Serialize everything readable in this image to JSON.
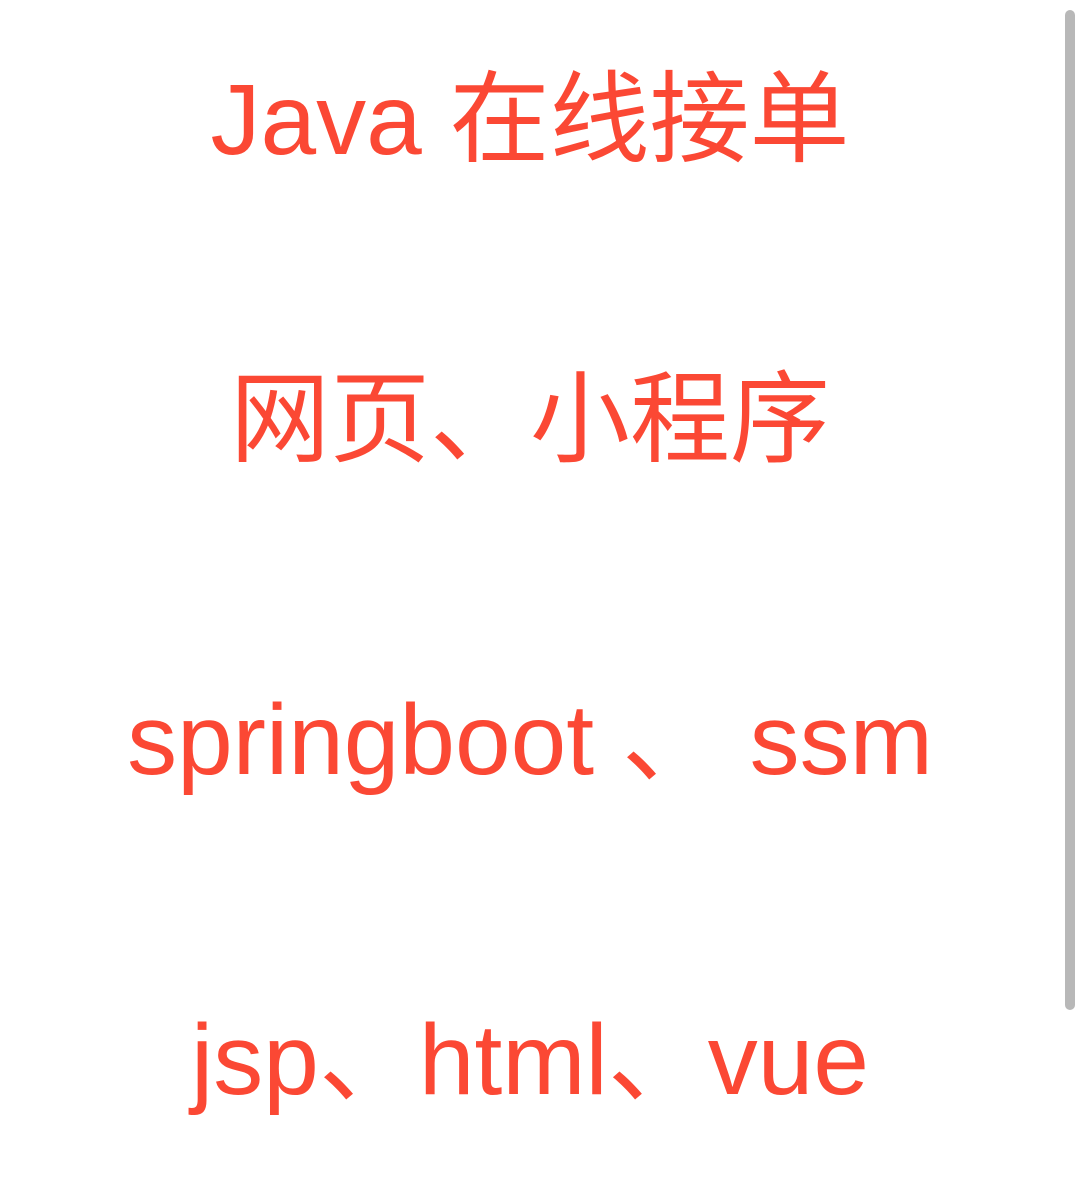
{
  "lines": {
    "l1": "Java 在线接单",
    "l2": "网页、小程序",
    "l3": "springboot 、 ssm",
    "l4": "jsp、html、vue"
  },
  "colors": {
    "text": "#fb4834",
    "background": "#ffffff",
    "scrollbar": "#b8b8b8"
  }
}
